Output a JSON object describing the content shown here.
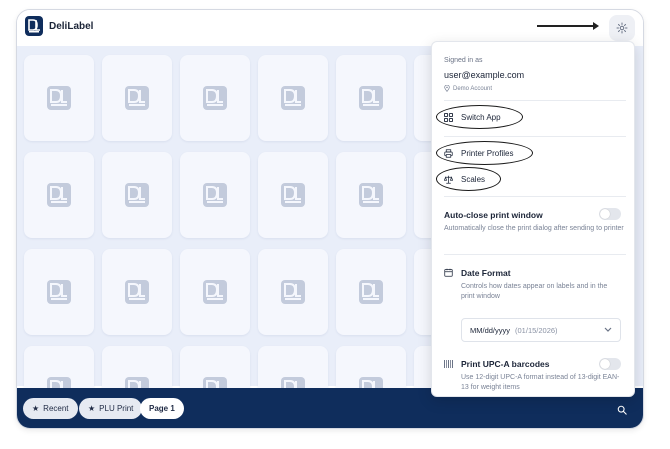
{
  "app": {
    "title": "DeliLabel",
    "logo_text": "DL"
  },
  "icons": {
    "settings": "gear-icon",
    "location": "pin-icon",
    "switch_app": "grid-icon",
    "printer": "printer-icon",
    "scales": "scale-icon",
    "calendar": "calendar-icon",
    "barcode": "barcode-icon",
    "dropdown": "chevron-down-icon",
    "search": "search-icon",
    "star": "star-icon"
  },
  "bottom_bar": {
    "chips": [
      {
        "label": "Recent",
        "icon": "star-icon"
      },
      {
        "label": "PLU Print",
        "icon": "star-icon"
      },
      {
        "label": "Page 1",
        "active": true
      }
    ]
  },
  "menu": {
    "signed_in_label": "Signed in as",
    "email": "user@example.com",
    "account": "Demo Account",
    "items": [
      {
        "label": "Switch App"
      },
      {
        "label": "Printer Profiles"
      },
      {
        "label": "Scales"
      }
    ],
    "settings": {
      "auto_close": {
        "title": "Auto-close print window",
        "description": "Automatically close the print dialog after sending to printer",
        "enabled": false
      },
      "date_format": {
        "title": "Date Format",
        "description": "Controls how dates appear on labels and in the print window",
        "selected": "MM/dd/yyyy",
        "example": "(01/15/2026)"
      },
      "upc": {
        "title": "Print UPC-A barcodes",
        "description": "Use 12-digit UPC-A format instead of 13-digit EAN-13 for weight items",
        "enabled": false
      }
    }
  },
  "colors": {
    "primary": "#0f2d5c",
    "grid_background": "#e9eef9",
    "tile": "#f5f7fd",
    "tile_icon": "#c3cbdc"
  }
}
